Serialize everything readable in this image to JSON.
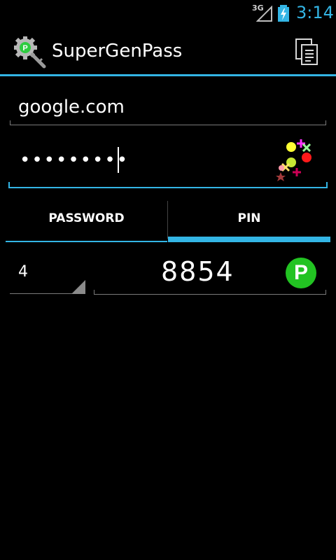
{
  "status_bar": {
    "network": "3G",
    "time": "3:14"
  },
  "app": {
    "title": "SuperGenPass"
  },
  "form": {
    "domain_value": "google.com",
    "password_masked": "•••••••••"
  },
  "tabs": [
    {
      "label": "PASSWORD",
      "selected": false
    },
    {
      "label": "PIN",
      "selected": true
    }
  ],
  "pin": {
    "length": "4",
    "result": "8854",
    "copy_badge": "P"
  },
  "colors": {
    "accent": "#33b5e5",
    "badge": "#22c322",
    "background": "#000000"
  },
  "icons": [
    "signal-icon",
    "battery-icon",
    "app-key-icon",
    "copy-icon",
    "visual-hash-icon",
    "pin-copy-icon"
  ]
}
